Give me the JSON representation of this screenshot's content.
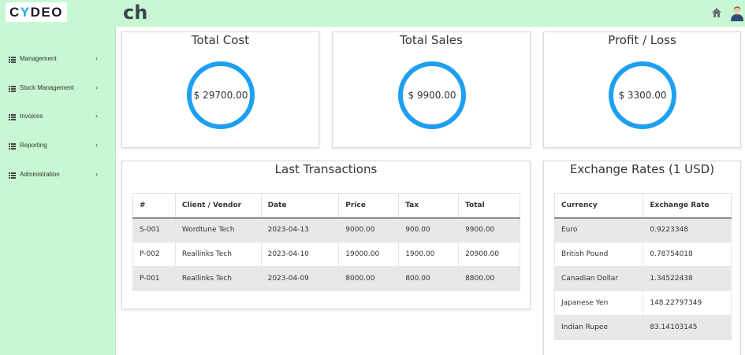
{
  "header": {
    "logo": "CYDEO",
    "title": "ch",
    "home_icon": "home-icon",
    "avatar_icon": "user-avatar-icon"
  },
  "sidebar": {
    "items": [
      {
        "label": "Management",
        "icon": "list-icon"
      },
      {
        "label": "Stock Management",
        "icon": "list-icon"
      },
      {
        "label": "Invoices",
        "icon": "list-icon"
      },
      {
        "label": "Reporting",
        "icon": "list-icon"
      },
      {
        "label": "Administration",
        "icon": "list-icon"
      }
    ]
  },
  "summary": {
    "total_cost": {
      "title": "Total Cost",
      "value": "$ 29700.00"
    },
    "total_sales": {
      "title": "Total Sales",
      "value": "$ 9900.00"
    },
    "profit_loss": {
      "title": "Profit / Loss",
      "value": "$ 3300.00"
    }
  },
  "transactions": {
    "title": "Last Transactions",
    "columns": [
      "#",
      "Client / Vendor",
      "Date",
      "Price",
      "Tax",
      "Total"
    ],
    "rows": [
      [
        "S-001",
        "Wordtune Tech",
        "2023-04-13",
        "9000.00",
        "900.00",
        "9900.00"
      ],
      [
        "P-002",
        "Reallinks Tech",
        "2023-04-10",
        "19000.00",
        "1900.00",
        "20900.00"
      ],
      [
        "P-001",
        "Reallinks Tech",
        "2023-04-09",
        "8000.00",
        "800.00",
        "8800.00"
      ]
    ]
  },
  "exchange": {
    "title": "Exchange Rates (1 USD)",
    "columns": [
      "Currency",
      "Exchange Rate"
    ],
    "rows": [
      [
        "Euro",
        "0.9223348"
      ],
      [
        "British Pound",
        "0.78754018"
      ],
      [
        "Canadian Dollar",
        "1.34522438"
      ],
      [
        "Japanese Yen",
        "148.22797349"
      ],
      [
        "Indian Rupee",
        "83.14103145"
      ]
    ]
  },
  "colors": {
    "sidebar_bg": "#c8f7d3",
    "ring": "#1e9ff2",
    "logo_accent": "#1fa9e6"
  }
}
